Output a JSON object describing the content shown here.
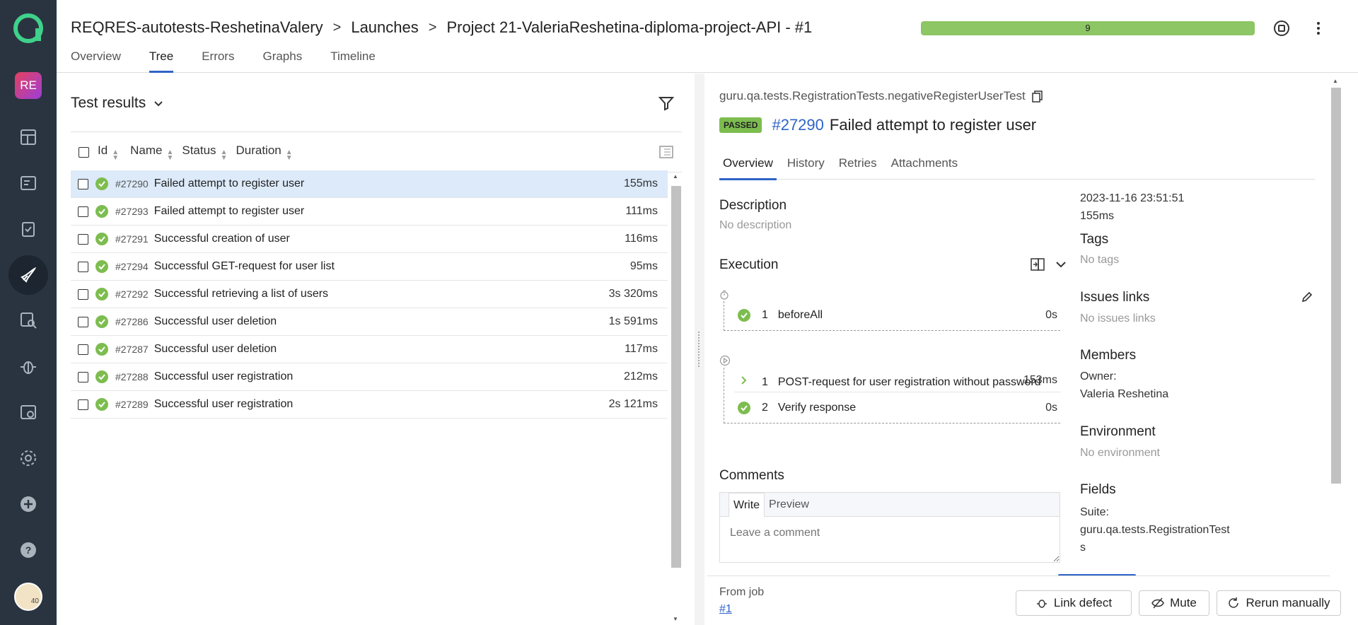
{
  "sidebar": {
    "project_badge": "RE",
    "user_badge": "40",
    "icons": [
      "dashboard-icon",
      "launches-icon",
      "testcases-icon",
      "rocket-icon",
      "analytics-icon",
      "bug-icon",
      "jobs-icon",
      "settings-icon",
      "add-icon",
      "help-icon"
    ]
  },
  "header": {
    "breadcrumb": [
      "REQRES-autotests-ReshetinaValery",
      "Launches",
      "Project 21-ValeriaReshetina-diploma-project-API - #1"
    ],
    "progress_value": "9",
    "progress_color": "#8cc665",
    "tabs": [
      "Overview",
      "Tree",
      "Errors",
      "Graphs",
      "Timeline"
    ],
    "active_tab": "Tree"
  },
  "tree": {
    "title": "Test results",
    "columns": [
      "Id",
      "Name",
      "Status",
      "Duration"
    ],
    "rows": [
      {
        "id": "#27290",
        "name": "Failed attempt to register user",
        "duration": "155ms",
        "selected": true
      },
      {
        "id": "#27293",
        "name": "Failed attempt to register user",
        "duration": "111ms"
      },
      {
        "id": "#27291",
        "name": "Successful creation of user",
        "duration": "116ms"
      },
      {
        "id": "#27294",
        "name": "Successful GET-request for user list",
        "duration": "95ms"
      },
      {
        "id": "#27292",
        "name": "Successful retrieving a list of users",
        "duration": "3s 320ms"
      },
      {
        "id": "#27286",
        "name": "Successful user deletion",
        "duration": "1s 591ms"
      },
      {
        "id": "#27287",
        "name": "Successful user deletion",
        "duration": "117ms"
      },
      {
        "id": "#27288",
        "name": "Successful user registration",
        "duration": "212ms"
      },
      {
        "id": "#27289",
        "name": "Successful user registration",
        "duration": "2s 121ms"
      }
    ]
  },
  "detail": {
    "fqn": "guru.qa.tests.RegistrationTests.negativeRegisterUserTest",
    "status": "PASSED",
    "test_id": "#27290",
    "title": "Failed attempt to register user",
    "tabs": [
      "Overview",
      "History",
      "Retries",
      "Attachments"
    ],
    "description_title": "Description",
    "description": "No description",
    "execution_title": "Execution",
    "before_steps": [
      {
        "n": "1",
        "name": "beforeAll",
        "duration": "0s"
      }
    ],
    "test_steps": [
      {
        "n": "1",
        "name": "POST-request for user registration without password",
        "duration": "153ms"
      },
      {
        "n": "2",
        "name": "Verify response",
        "duration": "0s"
      }
    ],
    "comments_title": "Comments",
    "comment_write": "Write",
    "comment_preview": "Preview",
    "comment_placeholder": "Leave a comment",
    "meta": {
      "date": "2023-11-16 23:51:51",
      "duration": "155ms",
      "tags_title": "Tags",
      "tags": "No tags",
      "issues_title": "Issues links",
      "issues": "No issues links",
      "members_title": "Members",
      "owner_label": "Owner:",
      "owner": "Valeria Reshetina",
      "env_title": "Environment",
      "env": "No environment",
      "fields_title": "Fields",
      "suite_label": "Suite:",
      "suite_line1": "guru.qa.tests.RegistrationTest",
      "suite_line2": "s"
    }
  },
  "footer": {
    "from_job": "From job",
    "job_link": "#1",
    "link_defect": "Link defect",
    "mute": "Mute",
    "rerun": "Rerun manually"
  }
}
